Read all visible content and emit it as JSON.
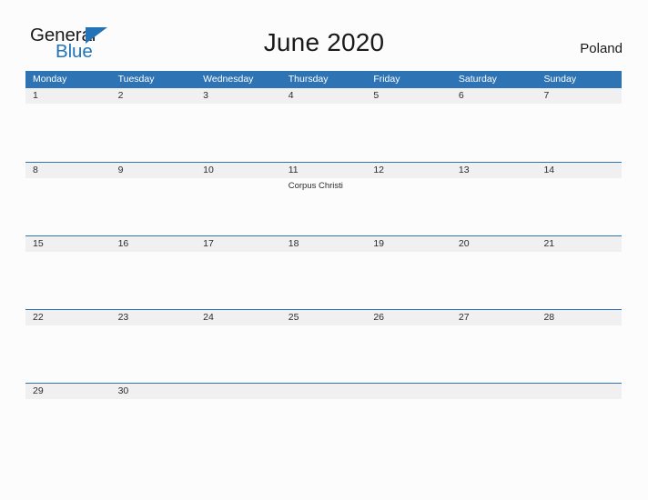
{
  "brand": {
    "name_part1": "General",
    "name_part2": "Blue",
    "triangle_icon": "triangle-icon",
    "color_blue": "#2273b8",
    "color_dark": "#1a1a1a"
  },
  "header": {
    "title": "June 2020",
    "country": "Poland"
  },
  "theme": {
    "header_blue": "#2e74b5",
    "band_gray": "#f0f0f0",
    "page_background": "#fcfcfc",
    "text_dark": "#2b2b2b"
  },
  "calendar": {
    "month": "June",
    "year": "2020",
    "weekdays": [
      "Monday",
      "Tuesday",
      "Wednesday",
      "Thursday",
      "Friday",
      "Saturday",
      "Sunday"
    ],
    "weeks": [
      [
        {
          "day": "1",
          "events": []
        },
        {
          "day": "2",
          "events": []
        },
        {
          "day": "3",
          "events": []
        },
        {
          "day": "4",
          "events": []
        },
        {
          "day": "5",
          "events": []
        },
        {
          "day": "6",
          "events": []
        },
        {
          "day": "7",
          "events": []
        }
      ],
      [
        {
          "day": "8",
          "events": []
        },
        {
          "day": "9",
          "events": []
        },
        {
          "day": "10",
          "events": []
        },
        {
          "day": "11",
          "events": [
            "Corpus Christi"
          ]
        },
        {
          "day": "12",
          "events": []
        },
        {
          "day": "13",
          "events": []
        },
        {
          "day": "14",
          "events": []
        }
      ],
      [
        {
          "day": "15",
          "events": []
        },
        {
          "day": "16",
          "events": []
        },
        {
          "day": "17",
          "events": []
        },
        {
          "day": "18",
          "events": []
        },
        {
          "day": "19",
          "events": []
        },
        {
          "day": "20",
          "events": []
        },
        {
          "day": "21",
          "events": []
        }
      ],
      [
        {
          "day": "22",
          "events": []
        },
        {
          "day": "23",
          "events": []
        },
        {
          "day": "24",
          "events": []
        },
        {
          "day": "25",
          "events": []
        },
        {
          "day": "26",
          "events": []
        },
        {
          "day": "27",
          "events": []
        },
        {
          "day": "28",
          "events": []
        }
      ],
      [
        {
          "day": "29",
          "events": []
        },
        {
          "day": "30",
          "events": []
        },
        {
          "day": "",
          "events": []
        },
        {
          "day": "",
          "events": []
        },
        {
          "day": "",
          "events": []
        },
        {
          "day": "",
          "events": []
        },
        {
          "day": "",
          "events": []
        }
      ]
    ]
  }
}
